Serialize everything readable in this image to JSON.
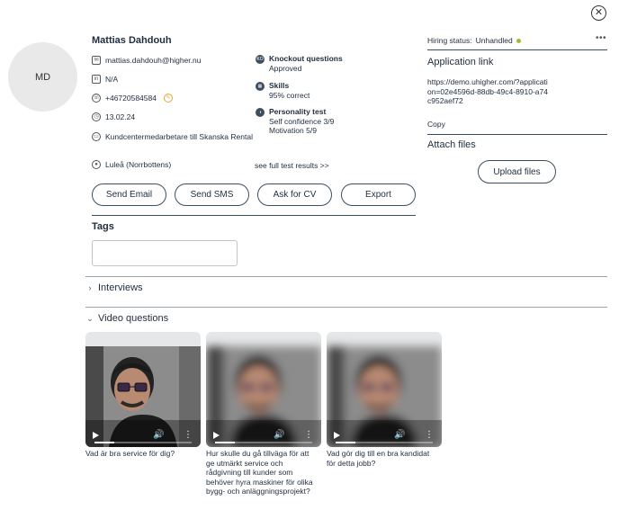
{
  "close_icon": "close-icon",
  "candidate": {
    "initials": "MD",
    "name": "Mattias Dahdouh",
    "email": "mattias.dahdouh@higher.nu",
    "linkedin": "N/A",
    "phone": "+46720584584",
    "date": "13.02.24",
    "position": "Kundcentermedarbetare till Skanska Rental",
    "location": "Luleå (Norrbottens)"
  },
  "tests": [
    {
      "icon": "ko-icon",
      "title": "Knockout questions",
      "lines": [
        "Approved"
      ]
    },
    {
      "icon": "skills-icon",
      "title": "Skills",
      "lines": [
        "95% correct"
      ]
    },
    {
      "icon": "personality-icon",
      "title": "Personality test",
      "lines": [
        "Self confidence 3/9",
        "Motivation 5/9"
      ]
    }
  ],
  "full_results_link": "see full test results >>",
  "actions": {
    "send_email": "Send Email",
    "send_sms": "Send SMS",
    "ask_cv": "Ask for CV",
    "export": "Export"
  },
  "tags": {
    "label": "Tags",
    "value": ""
  },
  "sections": {
    "interviews": "Interviews",
    "video_questions": "Video questions"
  },
  "right_panel": {
    "hiring_status_label": "Hiring status:",
    "hiring_status_value": "Unhandled",
    "status_color": "#9dbb2e",
    "application_link_title": "Application link",
    "application_link": "https://demo.uhigher.com/?application=02e4596d-88db-49c4-8910-a74c952aef72",
    "copy_label": "Copy",
    "attach_files_title": "Attach files",
    "upload_label": "Upload files"
  },
  "videos": [
    {
      "caption": "Vad är bra service för dig?",
      "progress": 0.2,
      "blurred": false
    },
    {
      "caption": "Hur skulle du gå tillväga för att ge utmärkt service och rådgivning till kunder som behöver hyra maskiner för olika bygg- och anläggningsprojekt?",
      "progress": 0.2,
      "blurred": true
    },
    {
      "caption": "Vad gör dig till en bra kandidat för detta jobb?",
      "progress": 0.2,
      "blurred": true
    }
  ],
  "colors": {
    "accent": "#3d4f5f",
    "text": "#1f2d3d"
  }
}
